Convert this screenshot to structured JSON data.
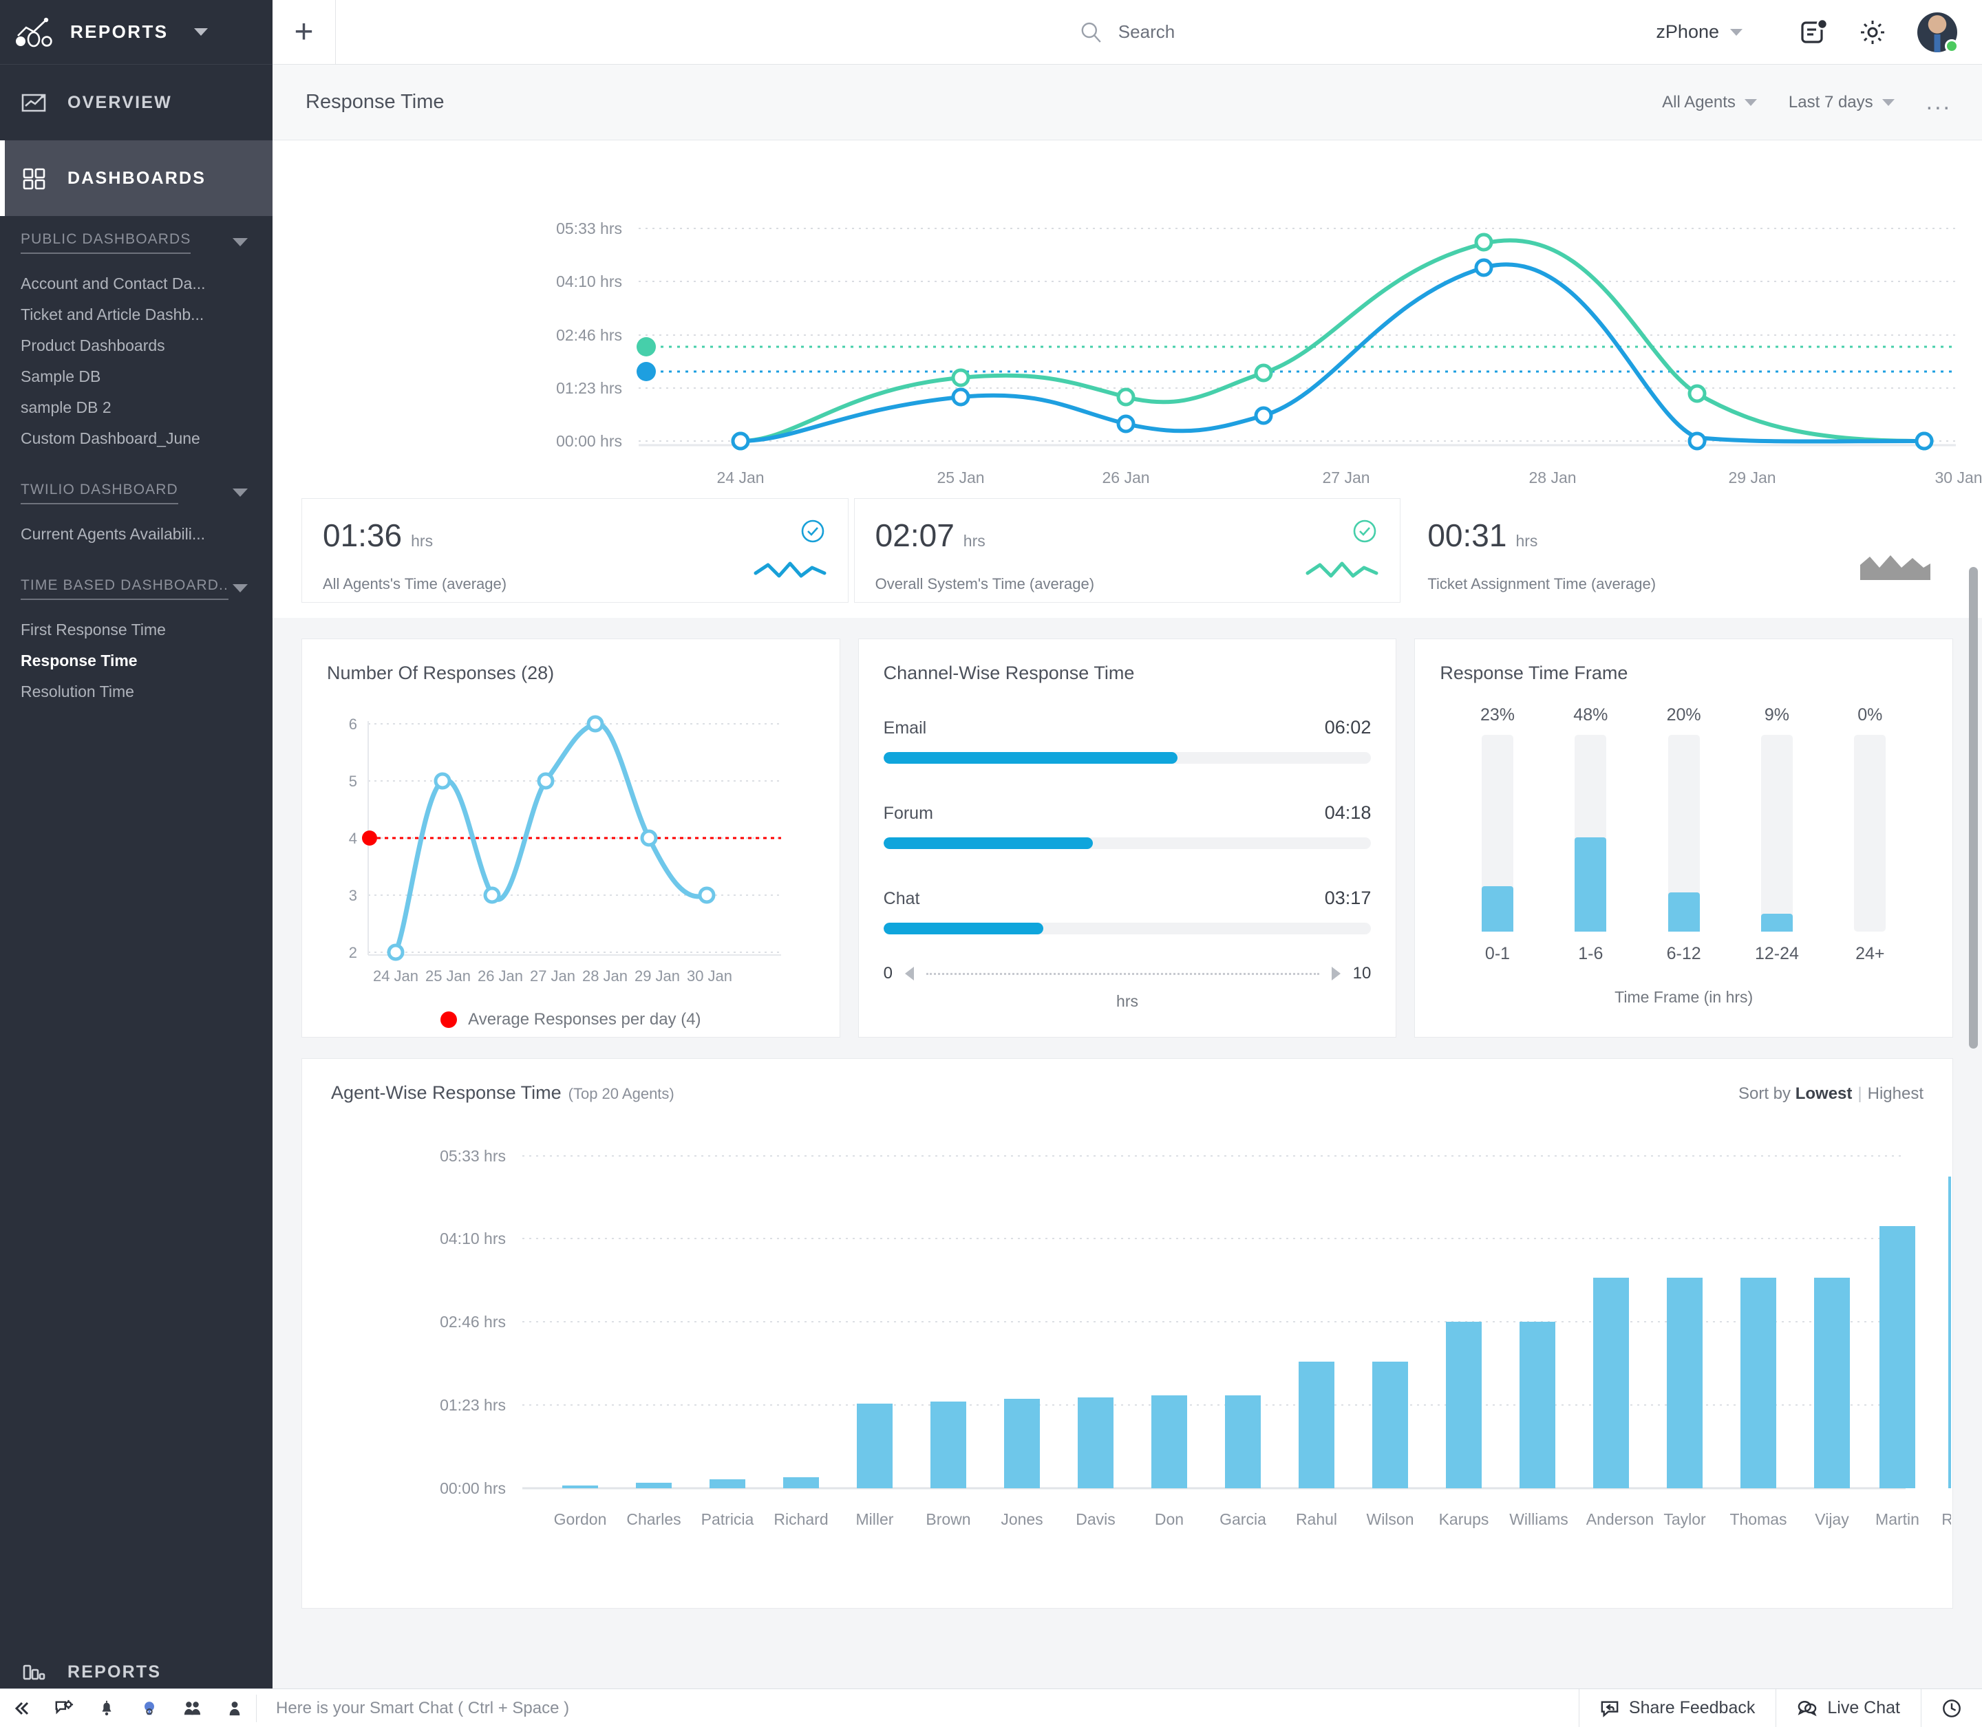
{
  "sidebar": {
    "brand": "REPORTS",
    "nav": [
      {
        "label": "OVERVIEW",
        "icon": "overview-icon"
      },
      {
        "label": "DASHBOARDS",
        "icon": "dashboards-grid-icon"
      }
    ],
    "groups": [
      {
        "label": "PUBLIC DASHBOARDS",
        "items": [
          "Account and Contact Da...",
          "Ticket and Article Dashb...",
          "Product Dashboards",
          "Sample DB",
          "sample DB 2",
          "Custom Dashboard_June"
        ]
      },
      {
        "label": "TWILIO DASHBOARD",
        "items": [
          "Current Agents Availabili..."
        ]
      },
      {
        "label": "TIME BASED DASHBOARD..",
        "items": [
          "First Response Time",
          "Response Time",
          "Resolution Time"
        ]
      }
    ],
    "selected_item": "Response Time",
    "bottom": {
      "label": "REPORTS",
      "icon": "bar-chart-icon"
    }
  },
  "topbar": {
    "add_icon": "plus-icon",
    "search": {
      "placeholder": "Search",
      "icon": "search-icon"
    },
    "org": "zPhone",
    "notes_icon": "notes-badge-icon",
    "settings_icon": "gear-icon",
    "avatar": {
      "name": "avatar",
      "status": "online"
    }
  },
  "pagehead": {
    "title": "Response Time",
    "agent_filter": "All Agents",
    "date_filter": "Last 7 days",
    "more": "..."
  },
  "kpis": [
    {
      "value": "01:36",
      "unit": "hrs",
      "label": "All Agents's Time (average)",
      "accent": "#18a0d8",
      "check": true
    },
    {
      "value": "02:07",
      "unit": "hrs",
      "label": "Overall System's Time (average)",
      "accent": "#46cfaa",
      "check": true
    },
    {
      "value": "00:31",
      "unit": "hrs",
      "label": "Ticket Assignment Time (average)",
      "accent": "#9a9a9a",
      "check": false
    }
  ],
  "cards": {
    "responses_title": "Number Of Responses (28)",
    "responses_legend": "Average Responses per day (4)",
    "channel_title": "Channel-Wise Response Time",
    "channel_axis_min": "0",
    "channel_axis_max": "10",
    "channel_axis_label": "hrs",
    "timeframe_title": "Response Time Frame",
    "timeframe_axis_label": "Time Frame (in hrs)",
    "agent_title": "Agent-Wise Response Time",
    "agent_subtitle": "(Top 20 Agents)",
    "sort_by": "Sort by",
    "sort_lowest": "Lowest",
    "sort_sep": "|",
    "sort_highest": "Highest"
  },
  "bottombar": {
    "hint": "Here is your Smart Chat ( Ctrl + Space )",
    "icons": [
      "collapse-icon",
      "chat-gear-icon",
      "bell-icon",
      "location-pin-icon",
      "users-icon",
      "user-icon"
    ],
    "share_feedback": "Share Feedback",
    "live_chat": "Live Chat",
    "clock_icon": "clock-icon"
  },
  "chart_data": [
    {
      "type": "line",
      "title": "Response Time",
      "categories": [
        "24 Jan",
        "25 Jan",
        "26 Jan",
        "27 Jan",
        "28 Jan",
        "29 Jan",
        "30 Jan"
      ],
      "ytick_labels": [
        "00:00 hrs",
        "01:23 hrs",
        "02:46 hrs",
        "04:10 hrs",
        "05:33 hrs"
      ],
      "ytick_values": [
        0,
        1.383,
        2.767,
        4.167,
        5.55
      ],
      "ylim": [
        0,
        5.55
      ],
      "grid": true,
      "legend": "none",
      "series": [
        {
          "name": "Overall System's Time (average)",
          "color": "#46cfaa",
          "values": [
            0.0,
            1.82,
            1.22,
            1.85,
            5.72,
            1.22,
            0.0
          ],
          "marker_value_line": 1.95
        },
        {
          "name": "All Agents's Time (average)",
          "color": "#1e9fe0",
          "values": [
            0.0,
            1.22,
            0.0,
            0.55,
            4.72,
            0.0,
            0.0
          ],
          "marker_value_line": 1.7
        }
      ]
    },
    {
      "type": "line",
      "title": "Number Of Responses (28)",
      "categories": [
        "24 Jan",
        "25 Jan",
        "26 Jan",
        "27 Jan",
        "28 Jan",
        "29 Jan",
        "30 Jan"
      ],
      "values": [
        2,
        5,
        3,
        5,
        6,
        4,
        3
      ],
      "ytick_labels": [
        "2",
        "3",
        "4",
        "5",
        "6"
      ],
      "ylim": [
        2,
        6
      ],
      "series_color": "#6ec7ea",
      "average_line": {
        "value": 4,
        "color": "#fe0000",
        "label": "Average Responses per day (4)"
      },
      "grid": true
    },
    {
      "type": "bar",
      "orientation": "horizontal",
      "title": "Channel-Wise Response Time",
      "xlabel": "hrs",
      "xlim": [
        0,
        10
      ],
      "bar_color": "#0fa5dc",
      "categories": [
        "Email",
        "Forum",
        "Chat"
      ],
      "value_labels": [
        "06:02",
        "04:18",
        "03:17"
      ],
      "values": [
        6.03,
        4.3,
        3.28
      ]
    },
    {
      "type": "bar",
      "title": "Response Time Frame",
      "xlabel": "Time Frame (in hrs)",
      "categories": [
        "0-1",
        "1-6",
        "6-12",
        "12-24",
        "24+"
      ],
      "values": [
        23,
        48,
        20,
        9,
        0
      ],
      "value_labels": [
        "23%",
        "48%",
        "20%",
        "9%",
        "0%"
      ],
      "ylim": [
        0,
        100
      ],
      "bar_color": "#6ec7ea"
    },
    {
      "type": "bar",
      "title": "Agent-Wise Response Time",
      "subtitle": "(Top 20 Agents)",
      "ytick_labels": [
        "00:00 hrs",
        "01:23 hrs",
        "02:46 hrs",
        "04:10 hrs",
        "05:33 hrs"
      ],
      "ylim": [
        0,
        5.55
      ],
      "bar_color": "#6ec7ea",
      "categories": [
        "Gordon",
        "Charles",
        "Patricia",
        "Richard",
        "Miller",
        "Brown",
        "Jones",
        "Davis",
        "Don",
        "Garcia",
        "Rahul",
        "Wilson",
        "Karups",
        "Williams",
        "Anderson",
        "Taylor",
        "Thomas",
        "Vijay",
        "Martin",
        "Remila"
      ],
      "values": [
        0.02,
        0.04,
        0.08,
        0.09,
        1.02,
        1.05,
        1.08,
        1.1,
        1.12,
        1.12,
        1.58,
        1.58,
        2.22,
        2.22,
        2.94,
        2.94,
        2.94,
        2.94,
        4.26,
        5.2
      ]
    }
  ]
}
